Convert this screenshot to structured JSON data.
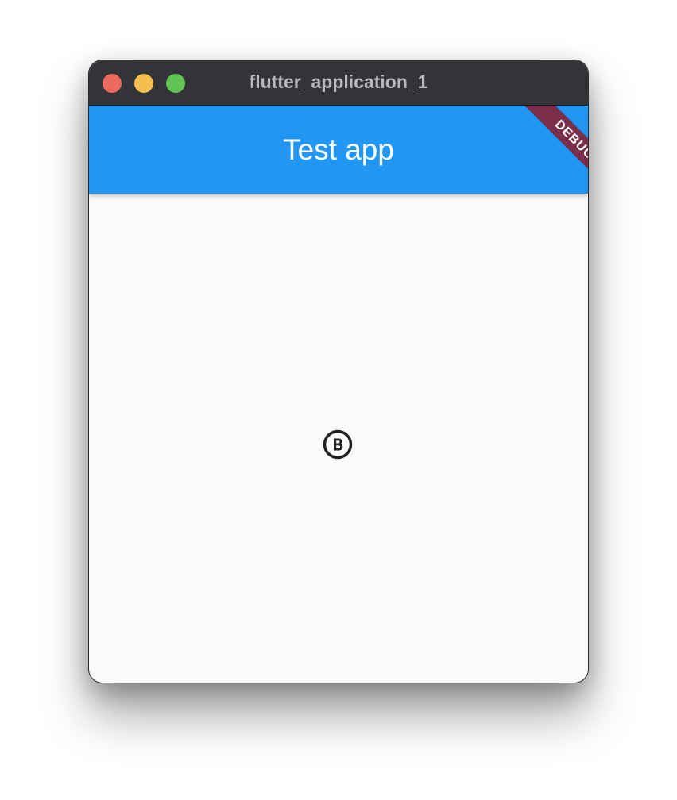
{
  "window": {
    "title": "flutter_application_1"
  },
  "appbar": {
    "title": "Test app"
  },
  "debug_banner": {
    "label": "DEBUG"
  },
  "body": {
    "icon": "circled-b-icon"
  },
  "colors": {
    "titlebar": "#333437",
    "close": "#ed6a5e",
    "minimize": "#f5bf4f",
    "maximize": "#61c554",
    "appbar": "#2196f3",
    "debug": "#7a2e4a",
    "body": "#fafafa",
    "icon": "#212121"
  }
}
